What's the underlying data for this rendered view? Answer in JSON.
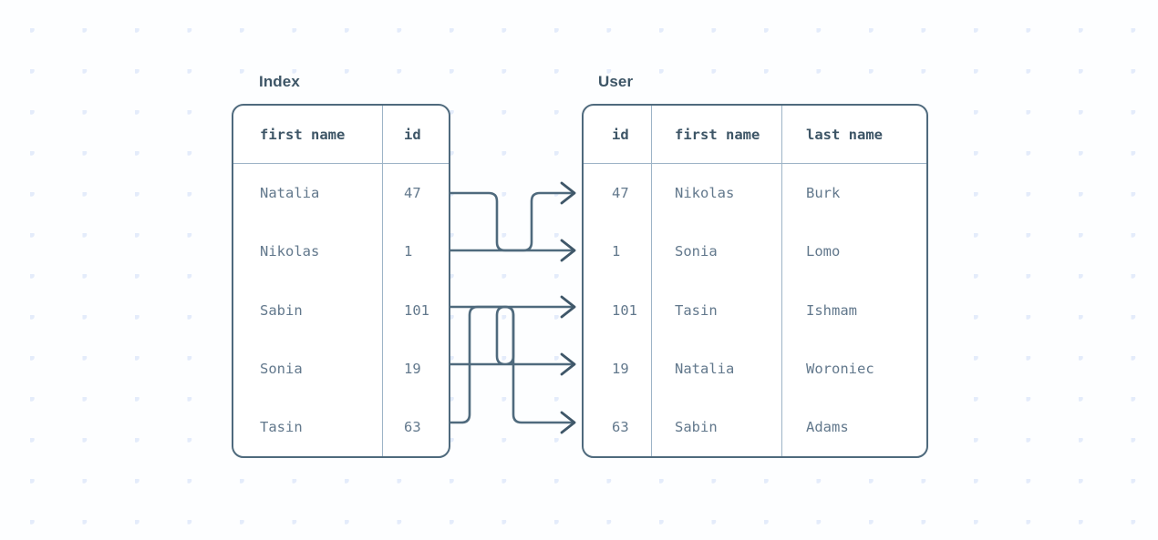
{
  "diagram": {
    "kind": "table-join-mapping",
    "accent_color": "#4f6a7d",
    "grid_color": "#9db4c7",
    "text_color": "#62788c",
    "heading_color": "#3d5566",
    "background_color": "#fdfeff",
    "dot_color": "#e4ecfb"
  },
  "index_table": {
    "title": "Index",
    "columns": [
      "first name",
      "id"
    ],
    "rows": [
      {
        "first_name": "Natalia",
        "id": "47"
      },
      {
        "first_name": "Nikolas",
        "id": "1"
      },
      {
        "first_name": "Sabin",
        "id": "101"
      },
      {
        "first_name": "Sonia",
        "id": "19"
      },
      {
        "first_name": "Tasin",
        "id": "63"
      }
    ]
  },
  "user_table": {
    "title": "User",
    "columns": [
      "id",
      "first name",
      "last name"
    ],
    "rows": [
      {
        "id": "47",
        "first_name": "Nikolas",
        "last_name": "Burk"
      },
      {
        "id": "1",
        "first_name": "Sonia",
        "last_name": "Lomo"
      },
      {
        "id": "101",
        "first_name": "Tasin",
        "last_name": "Ishmam"
      },
      {
        "id": "19",
        "first_name": "Natalia",
        "last_name": "Woroniec"
      },
      {
        "id": "63",
        "first_name": "Sabin",
        "last_name": "Adams"
      }
    ]
  },
  "connections": [
    {
      "from_index_row": 0,
      "from_id": "47",
      "to_user_row": 0
    },
    {
      "from_index_row": 1,
      "from_id": "1",
      "to_user_row": 1
    },
    {
      "from_index_row": 2,
      "from_id": "101",
      "to_user_row": 2
    },
    {
      "from_index_row": 3,
      "from_id": "19",
      "to_user_row": 3
    },
    {
      "from_index_row": 4,
      "from_id": "63",
      "to_user_row": 4
    }
  ]
}
